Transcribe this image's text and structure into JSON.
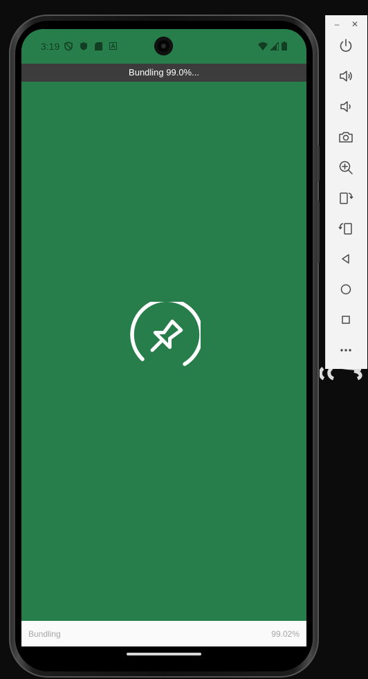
{
  "status_bar": {
    "time": "3:19"
  },
  "banner": {
    "text": "Bundling 99.0%..."
  },
  "bottom_bar": {
    "label": "Bundling",
    "percent": "99.02%"
  },
  "colors": {
    "app_background": "#277e4a",
    "banner_background": "#3c3c3c",
    "bottom_bar_background": "#fafafa",
    "panel_background": "#f3f3f3"
  },
  "emulator_panel": {
    "window_buttons": [
      "–",
      "✕"
    ],
    "buttons": [
      {
        "name": "power-icon"
      },
      {
        "name": "volume-up-icon"
      },
      {
        "name": "volume-down-icon"
      },
      {
        "name": "camera-icon"
      },
      {
        "name": "zoom-in-icon"
      },
      {
        "name": "rotate-left-icon"
      },
      {
        "name": "rotate-right-icon"
      },
      {
        "name": "back-icon"
      },
      {
        "name": "home-icon"
      },
      {
        "name": "overview-icon"
      },
      {
        "name": "more-icon"
      }
    ]
  }
}
